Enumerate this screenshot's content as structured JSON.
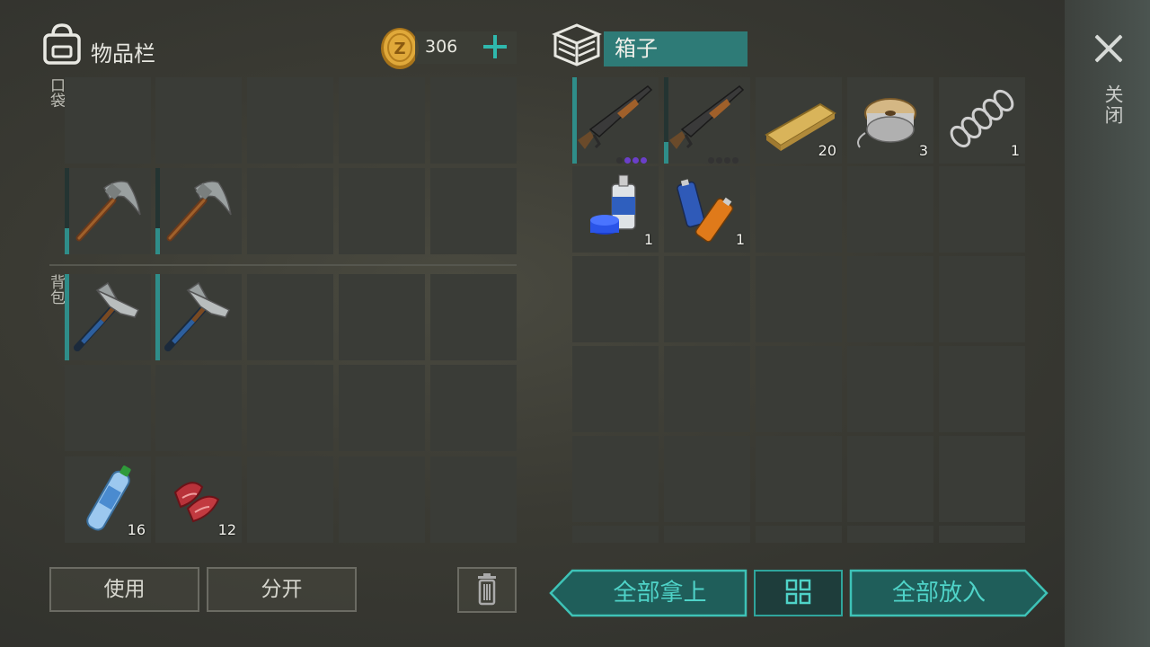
{
  "inventory": {
    "title": "物品栏",
    "coins": "306",
    "pocket_label": "口袋",
    "backpack_label": "背包",
    "pocket_slots": [
      {
        "item": "",
        "qty": ""
      },
      {
        "item": "",
        "qty": ""
      },
      {
        "item": "",
        "qty": ""
      },
      {
        "item": "",
        "qty": ""
      },
      {
        "item": "",
        "qty": ""
      },
      {
        "item": "pickaxe",
        "qty": "",
        "durability": 0.3
      },
      {
        "item": "pickaxe",
        "qty": "",
        "durability": 0.3
      },
      {
        "item": "",
        "qty": ""
      },
      {
        "item": "",
        "qty": ""
      },
      {
        "item": "",
        "qty": ""
      }
    ],
    "backpack_slots": [
      {
        "item": "pickaxe-blue",
        "qty": "",
        "durability": 1
      },
      {
        "item": "pickaxe-blue",
        "qty": "",
        "durability": 1
      },
      {
        "item": "",
        "qty": ""
      },
      {
        "item": "",
        "qty": ""
      },
      {
        "item": "",
        "qty": ""
      },
      {
        "item": "",
        "qty": ""
      },
      {
        "item": "",
        "qty": ""
      },
      {
        "item": "",
        "qty": ""
      },
      {
        "item": "",
        "qty": ""
      },
      {
        "item": "",
        "qty": ""
      },
      {
        "item": "water-bottle",
        "qty": "16"
      },
      {
        "item": "raw-meat",
        "qty": "12"
      },
      {
        "item": "",
        "qty": ""
      },
      {
        "item": "",
        "qty": ""
      },
      {
        "item": "",
        "qty": ""
      }
    ],
    "use_label": "使用",
    "split_label": "分开"
  },
  "box": {
    "title": "箱子",
    "slots": [
      {
        "item": "shotgun",
        "qty": "",
        "durability": 1,
        "dots": [
          "#333",
          "#6b3fc9",
          "#6b3fc9",
          "#6b3fc9"
        ]
      },
      {
        "item": "shotgun",
        "qty": "",
        "durability": 0.25,
        "dots": [
          "#333",
          "#333",
          "#333",
          "#333"
        ]
      },
      {
        "item": "plank",
        "qty": "20"
      },
      {
        "item": "wire-spool",
        "qty": "3"
      },
      {
        "item": "spring",
        "qty": "1"
      },
      {
        "item": "spray-paint",
        "qty": "1"
      },
      {
        "item": "batteries",
        "qty": "1"
      }
    ],
    "take_all_label": "全部拿上",
    "put_all_label": "全部放入"
  },
  "close_label": "关闭",
  "colors": {
    "accent": "#2fb8ad",
    "box_title_bg": "#2e7b77"
  }
}
